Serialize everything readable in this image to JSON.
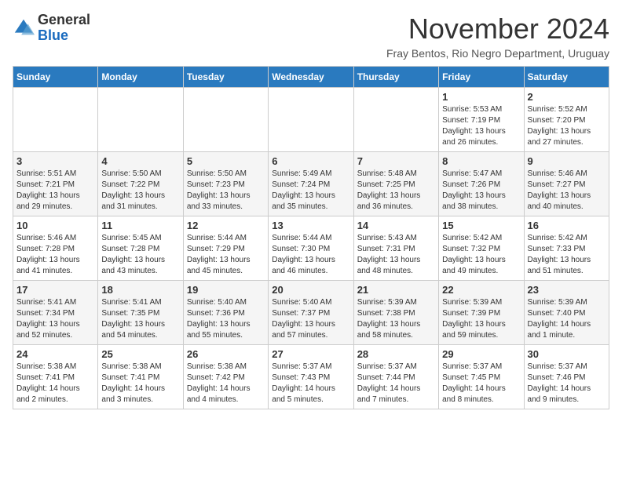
{
  "logo": {
    "general": "General",
    "blue": "Blue"
  },
  "header": {
    "title": "November 2024",
    "subtitle": "Fray Bentos, Rio Negro Department, Uruguay"
  },
  "days_of_week": [
    "Sunday",
    "Monday",
    "Tuesday",
    "Wednesday",
    "Thursday",
    "Friday",
    "Saturday"
  ],
  "weeks": [
    [
      {
        "day": "",
        "info": ""
      },
      {
        "day": "",
        "info": ""
      },
      {
        "day": "",
        "info": ""
      },
      {
        "day": "",
        "info": ""
      },
      {
        "day": "",
        "info": ""
      },
      {
        "day": "1",
        "info": "Sunrise: 5:53 AM\nSunset: 7:19 PM\nDaylight: 13 hours and 26 minutes."
      },
      {
        "day": "2",
        "info": "Sunrise: 5:52 AM\nSunset: 7:20 PM\nDaylight: 13 hours and 27 minutes."
      }
    ],
    [
      {
        "day": "3",
        "info": "Sunrise: 5:51 AM\nSunset: 7:21 PM\nDaylight: 13 hours and 29 minutes."
      },
      {
        "day": "4",
        "info": "Sunrise: 5:50 AM\nSunset: 7:22 PM\nDaylight: 13 hours and 31 minutes."
      },
      {
        "day": "5",
        "info": "Sunrise: 5:50 AM\nSunset: 7:23 PM\nDaylight: 13 hours and 33 minutes."
      },
      {
        "day": "6",
        "info": "Sunrise: 5:49 AM\nSunset: 7:24 PM\nDaylight: 13 hours and 35 minutes."
      },
      {
        "day": "7",
        "info": "Sunrise: 5:48 AM\nSunset: 7:25 PM\nDaylight: 13 hours and 36 minutes."
      },
      {
        "day": "8",
        "info": "Sunrise: 5:47 AM\nSunset: 7:26 PM\nDaylight: 13 hours and 38 minutes."
      },
      {
        "day": "9",
        "info": "Sunrise: 5:46 AM\nSunset: 7:27 PM\nDaylight: 13 hours and 40 minutes."
      }
    ],
    [
      {
        "day": "10",
        "info": "Sunrise: 5:46 AM\nSunset: 7:28 PM\nDaylight: 13 hours and 41 minutes."
      },
      {
        "day": "11",
        "info": "Sunrise: 5:45 AM\nSunset: 7:28 PM\nDaylight: 13 hours and 43 minutes."
      },
      {
        "day": "12",
        "info": "Sunrise: 5:44 AM\nSunset: 7:29 PM\nDaylight: 13 hours and 45 minutes."
      },
      {
        "day": "13",
        "info": "Sunrise: 5:44 AM\nSunset: 7:30 PM\nDaylight: 13 hours and 46 minutes."
      },
      {
        "day": "14",
        "info": "Sunrise: 5:43 AM\nSunset: 7:31 PM\nDaylight: 13 hours and 48 minutes."
      },
      {
        "day": "15",
        "info": "Sunrise: 5:42 AM\nSunset: 7:32 PM\nDaylight: 13 hours and 49 minutes."
      },
      {
        "day": "16",
        "info": "Sunrise: 5:42 AM\nSunset: 7:33 PM\nDaylight: 13 hours and 51 minutes."
      }
    ],
    [
      {
        "day": "17",
        "info": "Sunrise: 5:41 AM\nSunset: 7:34 PM\nDaylight: 13 hours and 52 minutes."
      },
      {
        "day": "18",
        "info": "Sunrise: 5:41 AM\nSunset: 7:35 PM\nDaylight: 13 hours and 54 minutes."
      },
      {
        "day": "19",
        "info": "Sunrise: 5:40 AM\nSunset: 7:36 PM\nDaylight: 13 hours and 55 minutes."
      },
      {
        "day": "20",
        "info": "Sunrise: 5:40 AM\nSunset: 7:37 PM\nDaylight: 13 hours and 57 minutes."
      },
      {
        "day": "21",
        "info": "Sunrise: 5:39 AM\nSunset: 7:38 PM\nDaylight: 13 hours and 58 minutes."
      },
      {
        "day": "22",
        "info": "Sunrise: 5:39 AM\nSunset: 7:39 PM\nDaylight: 13 hours and 59 minutes."
      },
      {
        "day": "23",
        "info": "Sunrise: 5:39 AM\nSunset: 7:40 PM\nDaylight: 14 hours and 1 minute."
      }
    ],
    [
      {
        "day": "24",
        "info": "Sunrise: 5:38 AM\nSunset: 7:41 PM\nDaylight: 14 hours and 2 minutes."
      },
      {
        "day": "25",
        "info": "Sunrise: 5:38 AM\nSunset: 7:41 PM\nDaylight: 14 hours and 3 minutes."
      },
      {
        "day": "26",
        "info": "Sunrise: 5:38 AM\nSunset: 7:42 PM\nDaylight: 14 hours and 4 minutes."
      },
      {
        "day": "27",
        "info": "Sunrise: 5:37 AM\nSunset: 7:43 PM\nDaylight: 14 hours and 5 minutes."
      },
      {
        "day": "28",
        "info": "Sunrise: 5:37 AM\nSunset: 7:44 PM\nDaylight: 14 hours and 7 minutes."
      },
      {
        "day": "29",
        "info": "Sunrise: 5:37 AM\nSunset: 7:45 PM\nDaylight: 14 hours and 8 minutes."
      },
      {
        "day": "30",
        "info": "Sunrise: 5:37 AM\nSunset: 7:46 PM\nDaylight: 14 hours and 9 minutes."
      }
    ]
  ]
}
